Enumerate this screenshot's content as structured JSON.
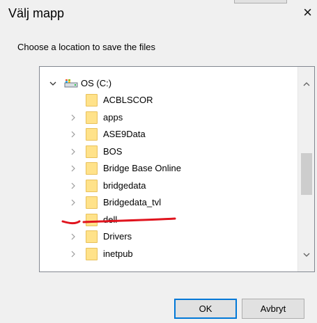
{
  "dialog": {
    "title": "Välj mapp",
    "close_symbol": "×",
    "instruction": "Choose a location to save the files"
  },
  "tree": {
    "root": {
      "label": "OS (C:)",
      "icon": "drive-icon",
      "expanded": true
    },
    "folders": [
      {
        "label": "ACBLSCOR",
        "has_children": false
      },
      {
        "label": "apps",
        "has_children": true
      },
      {
        "label": "ASE9Data",
        "has_children": true
      },
      {
        "label": "BOS",
        "has_children": true
      },
      {
        "label": "Bridge Base Online",
        "has_children": true
      },
      {
        "label": "bridgedata",
        "has_children": true
      },
      {
        "label": "Bridgedata_tvl",
        "has_children": true,
        "annotated": true
      },
      {
        "label": "dell",
        "has_children": false
      },
      {
        "label": "Drivers",
        "has_children": true
      },
      {
        "label": "inetpub",
        "has_children": true
      }
    ]
  },
  "buttons": {
    "ok": "OK",
    "cancel": "Avbryt"
  },
  "colors": {
    "annotation_red": "#e0141e",
    "default_button_border": "#0078d7",
    "folder_fill": "#ffe28a"
  }
}
